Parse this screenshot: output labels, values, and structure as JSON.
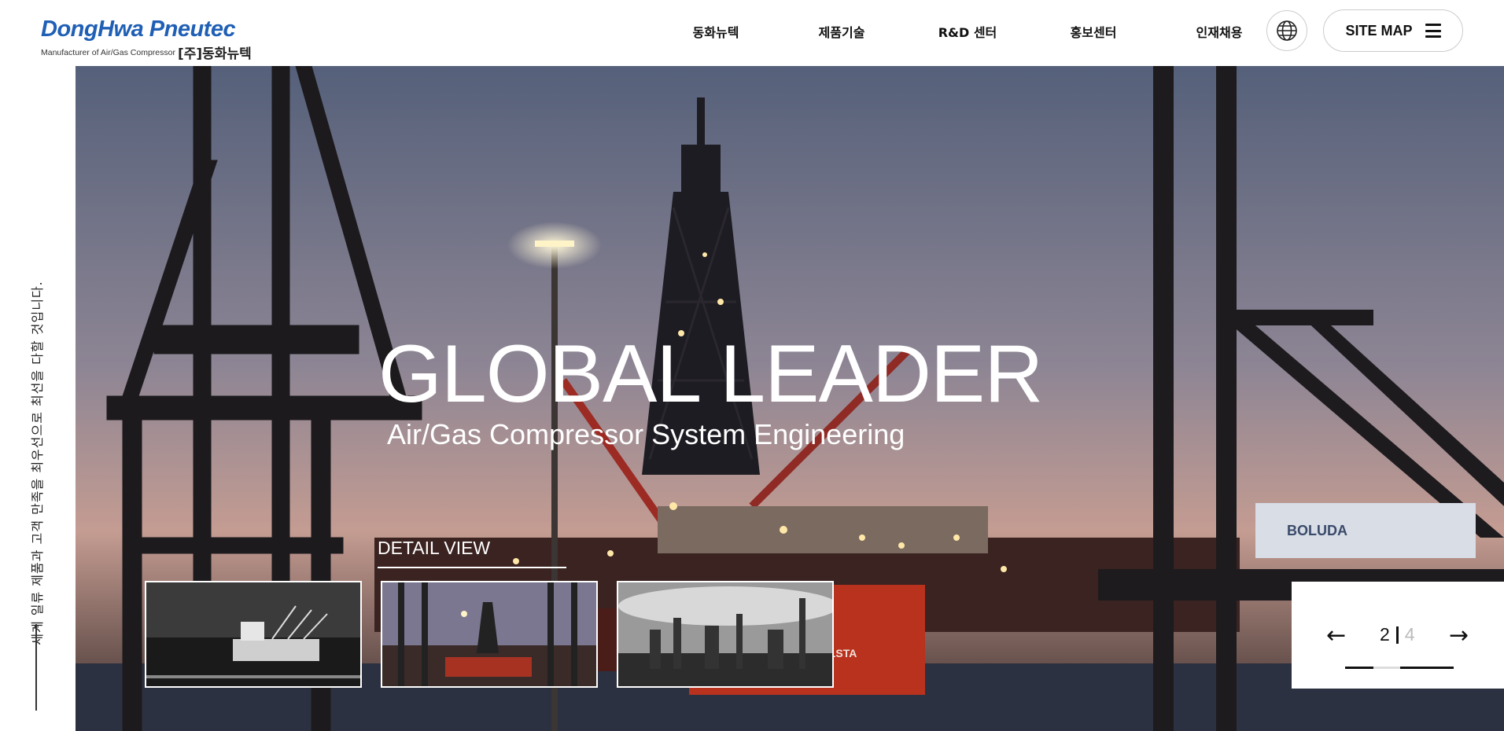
{
  "header": {
    "logo_main": "DongHwa Pneutec",
    "logo_sub": "Manufacturer of Air/Gas Compressor",
    "logo_kr": "[주]동화뉴텍",
    "nav": [
      "동화뉴텍",
      "제품기술",
      "R&D 센터",
      "홍보센터",
      "인재채용"
    ],
    "sitemap_label": "SITE MAP",
    "globe_icon": "globe-icon",
    "menu_icon": "hamburger-menu-icon"
  },
  "side": {
    "slogan": "세계 일류 제품과 고객 만족을 최우선으로 최선을 다할 것입니다."
  },
  "hero": {
    "title": "GLOBAL LEADER",
    "subtitle": "Air/Gas Compressor System Engineering",
    "detail_label": "DETAIL VIEW"
  },
  "slider": {
    "current": "2",
    "total": "4",
    "prev_icon": "arrow-left-icon",
    "next_icon": "arrow-right-icon"
  },
  "colors": {
    "brand_blue": "#1f5fb5",
    "sky_top": "#58627a",
    "sky_bottom": "#c99a8c",
    "rig_red": "#b8321e"
  }
}
